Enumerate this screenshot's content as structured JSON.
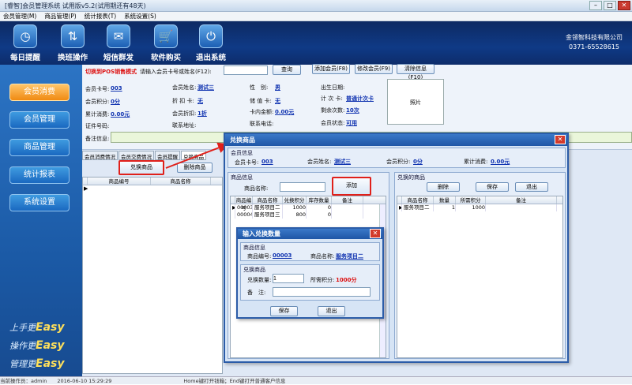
{
  "window": {
    "title": "[睿智]会员管理系统 试用版v5.2(试用期还有48天)"
  },
  "menu": [
    "会员管理(M)",
    "商品管理(P)",
    "统计报表(T)",
    "系统设置(S)"
  ],
  "toolbar": [
    {
      "label": "每日提醒",
      "icon": "clock-icon",
      "glyph": "◷"
    },
    {
      "label": "换班操作",
      "icon": "shift-icon",
      "glyph": "⇅"
    },
    {
      "label": "短信群发",
      "icon": "mail-icon",
      "glyph": "✉"
    },
    {
      "label": "软件购买",
      "icon": "cart-icon",
      "glyph": "🛒"
    },
    {
      "label": "退出系统",
      "icon": "power-icon",
      "glyph": "⏻"
    }
  ],
  "company": {
    "name": "金领智科技有限公司",
    "phone": "0371-65528615"
  },
  "sidebar": {
    "items": [
      "会员消费",
      "会员管理",
      "商品管理",
      "统计报表",
      "系统设置"
    ],
    "active": "会员消费"
  },
  "slogans": [
    {
      "text": "上手更",
      "em": "Easy"
    },
    {
      "text": "操作更",
      "em": "Easy"
    },
    {
      "text": "管理更",
      "em": "Easy"
    }
  ],
  "member": {
    "pos_mode": "切换到POS销售模式",
    "search_prompt": "请输入会员卡号或姓名(F12):",
    "search_value": "",
    "query_btn": "查询",
    "add_btn": "添加会员(F8)",
    "edit_btn": "修改会员(F9)",
    "clear_btn": "清除信息(F10)",
    "card_no_label": "会员卡号:",
    "card_no": "003",
    "name_label": "会员姓名:",
    "name": "测试三",
    "gender_label": "性　别:",
    "gender": "男",
    "birthday_label": "出生日期:",
    "birthday": "",
    "points_label": "会员积分:",
    "points": "0分",
    "discount_card_label": "折 扣 卡:",
    "discount_card": "无",
    "store_card_label": "储 值 卡:",
    "store_card": "无",
    "count_card_label": "计 次 卡:",
    "count_card": "普通计次卡",
    "total_label": "累计消费:",
    "total": "0.00元",
    "discount_label": "会员折扣:",
    "discount": "1折",
    "balance_label": "卡内金额:",
    "balance": "0.00元",
    "remain_label": "剩余次数:",
    "remain": "10次",
    "id_label": "证件号码:",
    "id": "",
    "contact_label": "联系地址:",
    "contact": "",
    "phone_label": "联系电话:",
    "phone": "",
    "status_label": "会员状态:",
    "status": "可用",
    "note_label": "备注信息:",
    "note": "",
    "photo": "照片"
  },
  "tabs": [
    "会员消费情况",
    "会员交费情况",
    "会员提醒",
    "兑换商品"
  ],
  "left_buttons": {
    "exchange": "兑换商品",
    "delete": "删除商品"
  },
  "left_grid": {
    "columns": [
      "商品编号",
      "商品名称"
    ]
  },
  "statusbar": {
    "text": "当前操作员：admin　　2016-06-10 15:29:29　　　　　　　　　　　　　　Home键打开钱箱；End键打开普通客户信息"
  },
  "dlg1": {
    "title": "兑换商品",
    "member_group": "会员信息",
    "card_label": "会员卡号:",
    "card": "003",
    "name_label": "会员姓名:",
    "name": "测试三",
    "points_label": "会员积分:",
    "points": "0分",
    "total_label": "累计消费:",
    "total": "0.00元",
    "goods_group": "商品信息",
    "goods_name_label": "商品名称:",
    "goods_name": "",
    "add_btn": "添加",
    "goods_columns": [
      "商品编号",
      "商品名称",
      "兑换积分",
      "库存数量",
      "备注"
    ],
    "goods_rows": [
      [
        "00003",
        "服务项目二",
        "1000",
        "0",
        ""
      ],
      [
        "00004",
        "服务项目三",
        "800",
        "0",
        ""
      ]
    ],
    "exch_group": "兑换的商品",
    "del_btn": "删除",
    "save_btn": "保存",
    "exit_btn": "退出",
    "exch_columns": [
      "商品名称",
      "数量",
      "所需积分",
      "备注"
    ],
    "exch_rows": [
      [
        "服务项目二",
        "1",
        "1000",
        ""
      ]
    ]
  },
  "dlg2": {
    "title": "输入兑换数量",
    "goods_group": "商品信息",
    "no_label": "商品编号:",
    "no": "00003",
    "name_label": "商品名称:",
    "name": "服务项目二",
    "exch_group": "兑换商品",
    "qty_label": "兑换数量:",
    "qty": "1",
    "need_label": "所需积分:",
    "need": "1000分",
    "note_label": "备　注:",
    "note": "",
    "save_btn": "保存",
    "exit_btn": "退出"
  }
}
